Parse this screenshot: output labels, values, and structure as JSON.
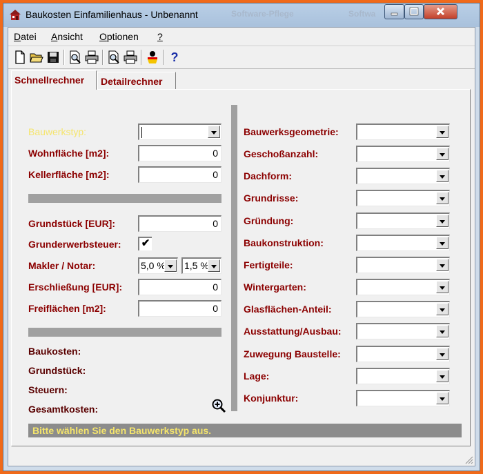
{
  "window": {
    "title": "Baukosten Einfamilienhaus - Unbenannt",
    "background_titles": [
      "Software-Pflege",
      "Softwa"
    ]
  },
  "menu": {
    "datei": {
      "label": "Datei",
      "mnemonic": "D",
      "rest": "atei"
    },
    "ansicht": {
      "label": "Ansicht",
      "mnemonic": "A",
      "rest": "nsicht"
    },
    "optionen": {
      "label": "Optionen",
      "mnemonic": "O",
      "rest": "ptionen"
    },
    "help": {
      "label": "?"
    }
  },
  "toolbar": {
    "icons": [
      "new-document-icon",
      "open-folder-icon",
      "save-disk-icon",
      "print-preview-icon",
      "print-icon",
      "print-preview-icon",
      "print-icon",
      "language-flag-de-icon",
      "help-icon"
    ],
    "help_label": "?"
  },
  "tabs": [
    {
      "label": "Schnellrechner",
      "active": true
    },
    {
      "label": "Detailrechner",
      "active": false
    }
  ],
  "left": {
    "bauwerkstyp": {
      "label": "Bauwerkstyp:",
      "value": ""
    },
    "wohnflaeche": {
      "label": "Wohnfläche [m2]:",
      "value": "0"
    },
    "kellerflaeche": {
      "label": "Kellerfläche [m2]:",
      "value": "0"
    },
    "grundstueck": {
      "label": "Grundstück [EUR]:",
      "value": "0"
    },
    "grunderwerbsteuer": {
      "label": "Grunderwerbsteuer:",
      "checked": true,
      "mark": "✔"
    },
    "makler": {
      "label": "Makler / Notar:",
      "makler_value": "5,0 %",
      "notar_value": "1,5 %"
    },
    "erschliessung": {
      "label": "Erschließung [EUR]:",
      "value": "0"
    },
    "freiflaechen": {
      "label": "Freiflächen [m2]:",
      "value": "0"
    }
  },
  "summary": {
    "baukosten": "Baukosten:",
    "grundstueck": "Grundstück:",
    "steuern": "Steuern:",
    "gesamtkosten": "Gesamtkosten:"
  },
  "right": [
    {
      "label": "Bauwerksgeometrie:",
      "value": ""
    },
    {
      "label": "Geschoßanzahl:",
      "value": ""
    },
    {
      "label": "Dachform:",
      "value": ""
    },
    {
      "label": "Grundrisse:",
      "value": ""
    },
    {
      "label": "Gründung:",
      "value": ""
    },
    {
      "label": "Baukonstruktion:",
      "value": ""
    },
    {
      "label": "Fertigteile:",
      "value": ""
    },
    {
      "label": "Wintergarten:",
      "value": ""
    },
    {
      "label": "Glasflächen-Anteil:",
      "value": ""
    },
    {
      "label": "Ausstattung/Ausbau:",
      "value": ""
    },
    {
      "label": "Zuwegung Baustelle:",
      "value": ""
    },
    {
      "label": "Lage:",
      "value": ""
    },
    {
      "label": "Konjunktur:",
      "value": ""
    }
  ],
  "status": "Bitte wählen Sie den Bauwerkstyp aus.",
  "colors": {
    "label": "#8b0000",
    "hint": "#f5e56c",
    "status_bg": "#8c8c8c",
    "outer_frame": "#f06a1a"
  }
}
